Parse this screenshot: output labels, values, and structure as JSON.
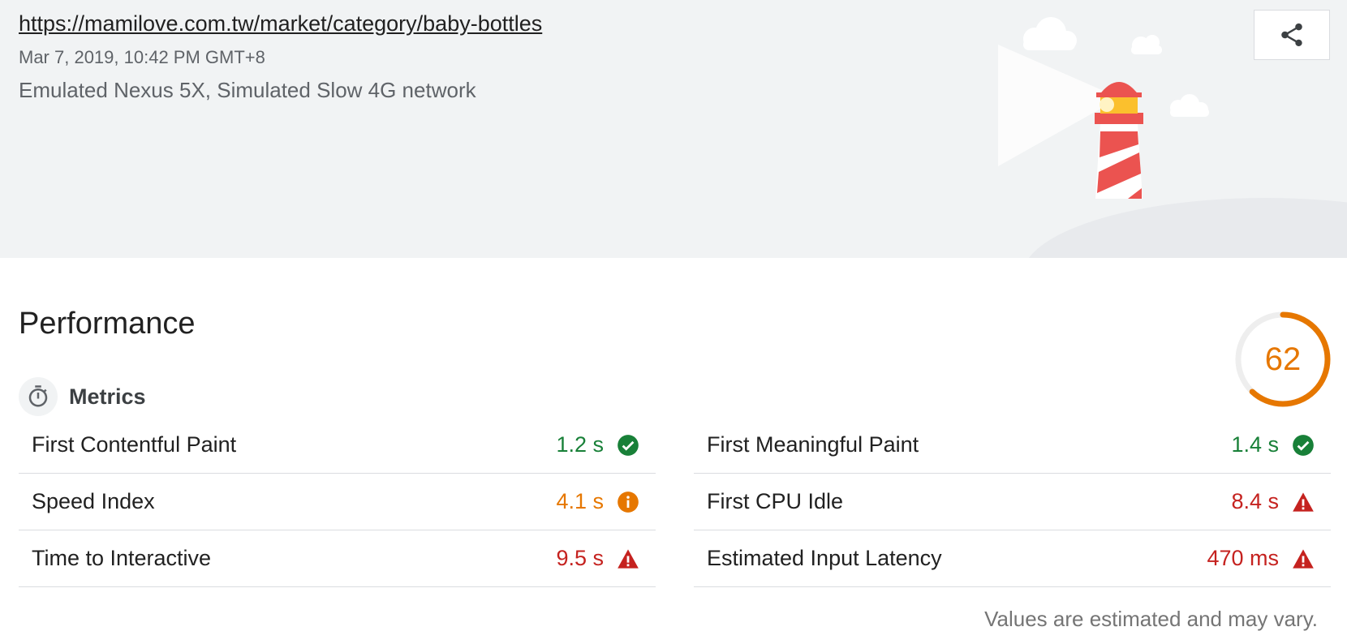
{
  "header": {
    "url": "https://mamilove.com.tw/market/category/baby-bottles",
    "timestamp": "Mar 7, 2019, 10:42 PM GMT+8",
    "device": "Emulated Nexus 5X, Simulated Slow 4G network",
    "share_icon": "share-icon",
    "illustration": "lighthouse-icon"
  },
  "performance": {
    "title": "Performance",
    "score": "62",
    "score_fraction": 0.62,
    "score_color": "#e67700",
    "metrics_label": "Metrics",
    "metrics_icon": "stopwatch-icon",
    "metrics_left": [
      {
        "name": "First Contentful Paint",
        "value": "1.2 s",
        "status": "pass"
      },
      {
        "name": "Speed Index",
        "value": "4.1 s",
        "status": "average"
      },
      {
        "name": "Time to Interactive",
        "value": "9.5 s",
        "status": "fail"
      }
    ],
    "metrics_right": [
      {
        "name": "First Meaningful Paint",
        "value": "1.4 s",
        "status": "pass"
      },
      {
        "name": "First CPU Idle",
        "value": "8.4 s",
        "status": "fail"
      },
      {
        "name": "Estimated Input Latency",
        "value": "470 ms",
        "status": "fail"
      }
    ],
    "disclaimer": "Values are estimated and may vary."
  },
  "colors": {
    "pass": "#188038",
    "average": "#e67700",
    "fail": "#c5221f",
    "header_bg": "#f1f3f4"
  }
}
